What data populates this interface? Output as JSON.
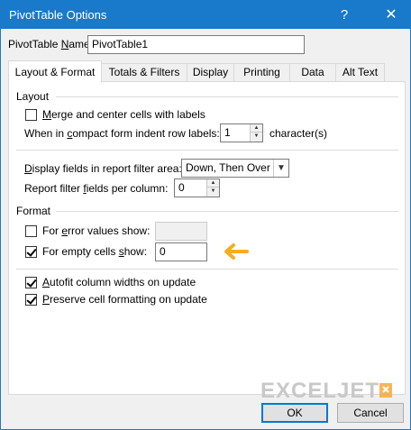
{
  "window": {
    "title": "PivotTable Options",
    "help_glyph": "?",
    "close_glyph": "✕"
  },
  "name_field": {
    "label_prefix": "PivotTable ",
    "label_underlined": "N",
    "label_suffix": "ame:",
    "value": "PivotTable1"
  },
  "tabs": [
    {
      "label": "Layout & Format",
      "active": true
    },
    {
      "label": "Totals & Filters",
      "active": false
    },
    {
      "label": "Display",
      "active": false
    },
    {
      "label": "Printing",
      "active": false
    },
    {
      "label": "Data",
      "active": false
    },
    {
      "label": "Alt Text",
      "active": false
    }
  ],
  "layout_group": {
    "title": "Layout",
    "merge_label_underlined": "M",
    "merge_label_rest": "erge and center cells with labels",
    "merge_checked": false,
    "indent_label_prefix": "When in ",
    "indent_label_underlined": "c",
    "indent_label_suffix": "ompact form indent row labels:",
    "indent_value": "1",
    "indent_unit": "character(s)",
    "display_fields_underlined": "D",
    "display_fields_rest": "isplay fields in report filter area:",
    "display_fields_value": "Down, Then Over",
    "filter_fields_prefix": "Report filter ",
    "filter_fields_underlined": "f",
    "filter_fields_suffix": "ields per column:",
    "filter_fields_value": "0"
  },
  "format_group": {
    "title": "Format",
    "error_label_prefix": "For ",
    "error_label_underlined": "e",
    "error_label_suffix": "rror values show:",
    "error_checked": false,
    "error_value": "",
    "empty_label_prefix": "For empty cells ",
    "empty_label_underlined": "s",
    "empty_label_suffix": "how:",
    "empty_checked": true,
    "empty_value": "0",
    "autofit_underlined": "A",
    "autofit_rest": "utofit column widths on update",
    "autofit_checked": true,
    "preserve_underlined": "P",
    "preserve_rest": "reserve cell formatting on update",
    "preserve_checked": true
  },
  "annotation_color": "#f2b01e",
  "watermark": {
    "text": "EXCELJET",
    "color": "#c8c8c8",
    "accent": "#f7a83a"
  },
  "buttons": {
    "ok": "OK",
    "cancel": "Cancel"
  }
}
